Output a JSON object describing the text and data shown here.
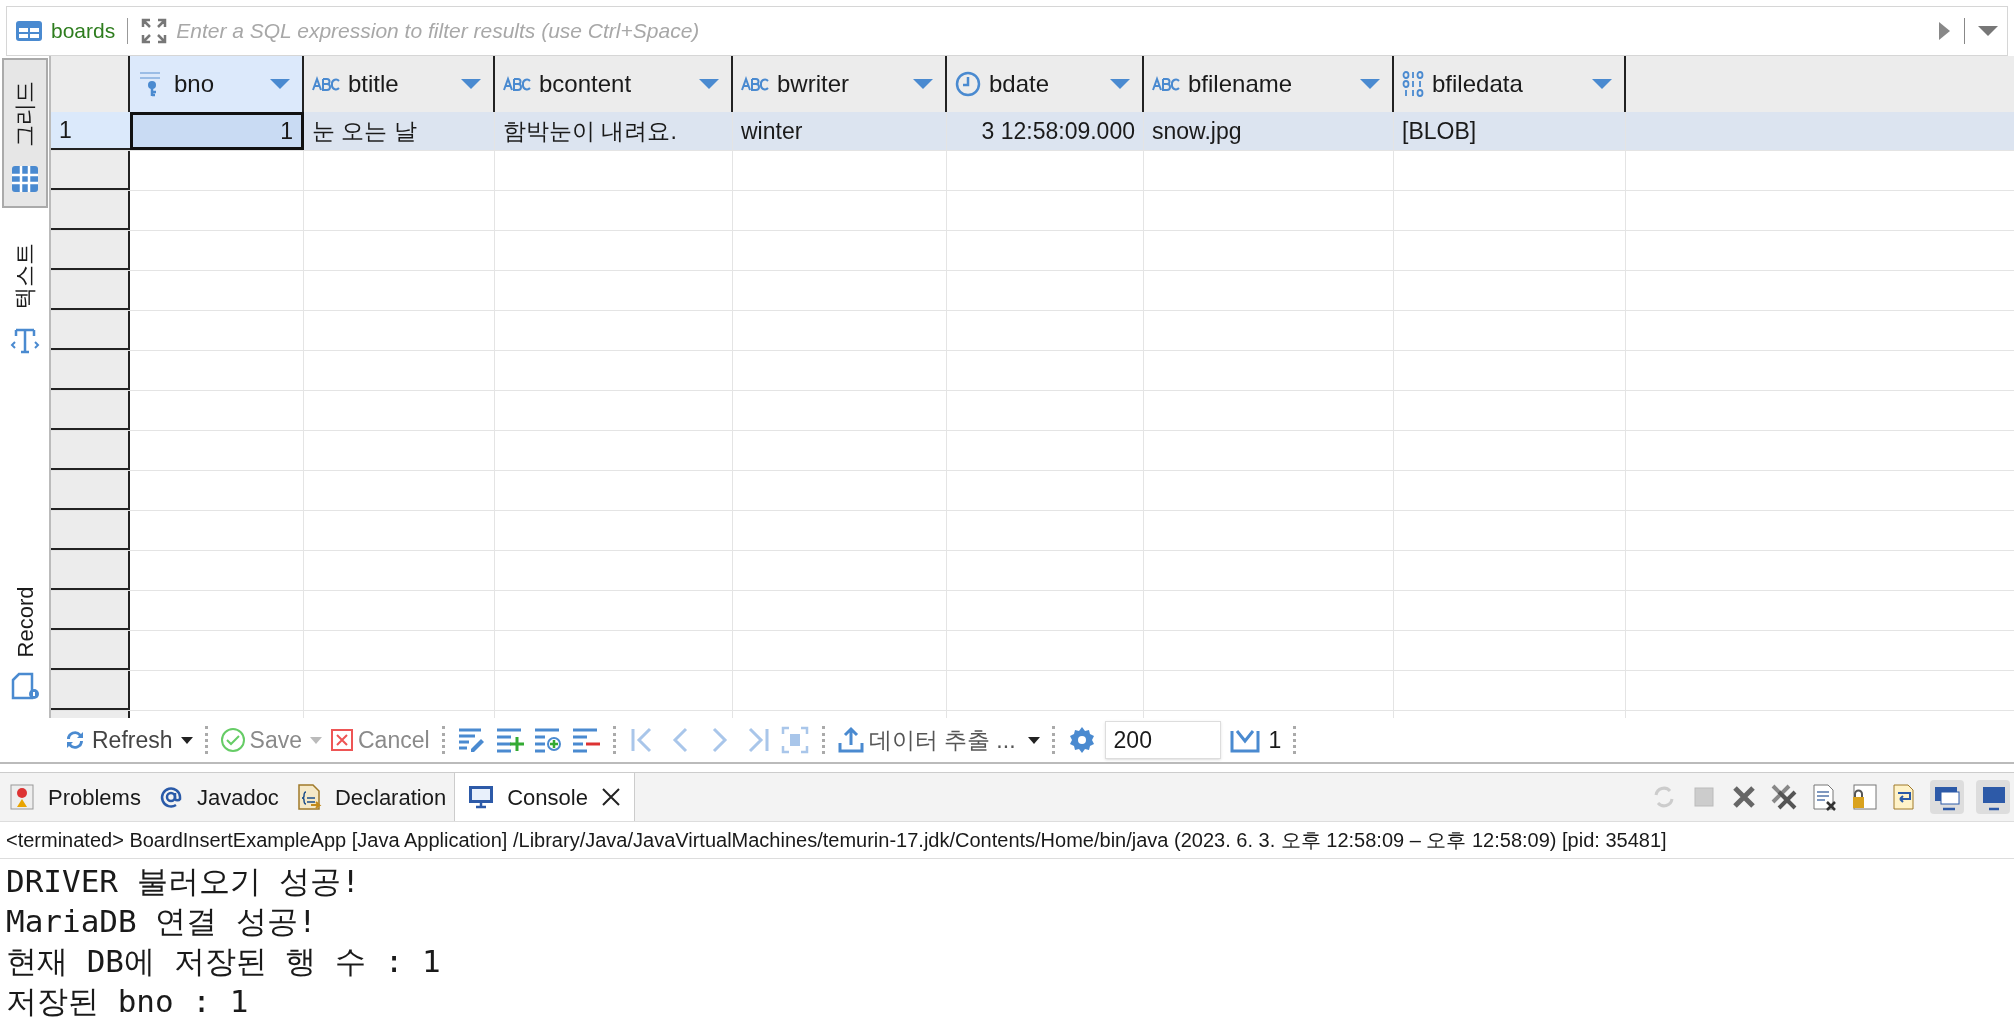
{
  "filter_bar": {
    "table_name": "boards",
    "placeholder": "Enter a SQL expression to filter results (use Ctrl+Space)"
  },
  "view_tabs": [
    {
      "label": "그리드",
      "kind": "grid",
      "selected": true
    },
    {
      "label": "텍스트",
      "kind": "text",
      "selected": false
    }
  ],
  "record_tab": {
    "label": "Record"
  },
  "table": {
    "columns": [
      {
        "name": "bno",
        "kind": "number",
        "selected": true
      },
      {
        "name": "btitle",
        "kind": "text",
        "selected": false
      },
      {
        "name": "bcontent",
        "kind": "text",
        "selected": false
      },
      {
        "name": "bwriter",
        "kind": "text",
        "selected": false
      },
      {
        "name": "bdate",
        "kind": "datetime",
        "selected": false
      },
      {
        "name": "bfilename",
        "kind": "text",
        "selected": false
      },
      {
        "name": "bfiledata",
        "kind": "binary",
        "selected": false
      }
    ],
    "rows": [
      {
        "row_number": "1",
        "selected": true,
        "cells": [
          "1",
          "눈 오는 날",
          "함박눈이 내려요.",
          "winter",
          "3 12:58:09.000",
          "snow.jpg",
          "[BLOB]"
        ]
      }
    ]
  },
  "toolbar": {
    "refresh": {
      "label": "Refresh",
      "disabled": false
    },
    "save": {
      "label": "Save",
      "disabled": true
    },
    "cancel": {
      "label": "Cancel",
      "disabled": true
    },
    "export": {
      "label": "데이터 추출 ..."
    },
    "fetch_size": "200",
    "row_count": "1"
  },
  "bottom_tabs": [
    {
      "label": "Problems",
      "kind": "problems",
      "selected": false
    },
    {
      "label": "Javadoc",
      "kind": "javadoc",
      "selected": false
    },
    {
      "label": "Declaration",
      "kind": "declaration",
      "selected": false
    },
    {
      "label": "Console",
      "kind": "console",
      "selected": true
    }
  ],
  "console": {
    "status": "<terminated> BoardInsertExampleApp [Java Application] /Library/Java/JavaVirtualMachines/temurin-17.jdk/Contents/Home/bin/java  (2023. 6. 3. 오후 12:58:09 – 오후 12:58:09) [pid: 35481]",
    "lines": [
      "DRIVER 불러오기 성공!",
      "MariaDB 연결 성공!",
      "현재 DB에 저장된 행 수 : 1",
      "저장된 bno : 1"
    ]
  }
}
